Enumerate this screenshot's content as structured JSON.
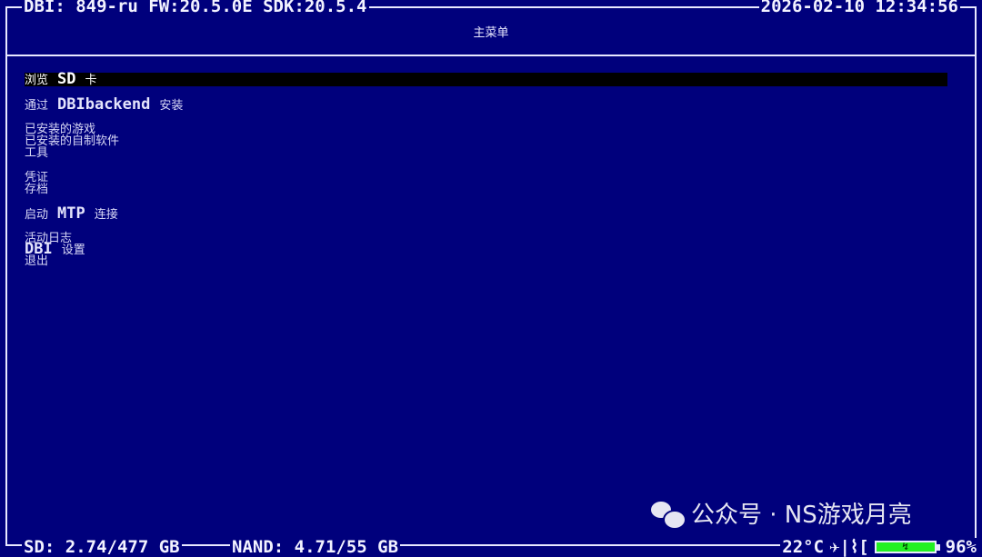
{
  "header": {
    "left_text": "DBI: 849-ru FW:20.5.0E SDK:20.5.4",
    "datetime": "2026-02-10 12:34:56"
  },
  "title": "主菜单",
  "menu": {
    "browse_sd": {
      "pre": "浏览",
      "bold": "SD",
      "post": "卡"
    },
    "install_backend": {
      "pre": "通过",
      "bold": "DBIbackend",
      "post": "安装"
    },
    "installed_games": "已安装的游戏",
    "installed_homebrew": "已安装的自制软件",
    "tools": "工具",
    "tickets": "凭证",
    "saves": "存档",
    "mtp": {
      "pre": "启动",
      "bold": "MTP",
      "post": "连接"
    },
    "activity_log": "活动日志",
    "settings": {
      "bold": "DBI",
      "post": "设置"
    },
    "exit": "退出"
  },
  "footer": {
    "sd_text": "SD: 2.74/477 GB",
    "nand_text": "NAND: 4.71/55 GB",
    "temperature": "22°C",
    "status_icons": "✈|⌇[",
    "battery_label": "↯",
    "battery_percent": "96%"
  },
  "watermark": {
    "text": "公众号 · NS游戏月亮"
  },
  "colors": {
    "background": "#00007c",
    "foreground": "#e8e8ff",
    "selection": "#000000",
    "battery": "#22f022"
  }
}
